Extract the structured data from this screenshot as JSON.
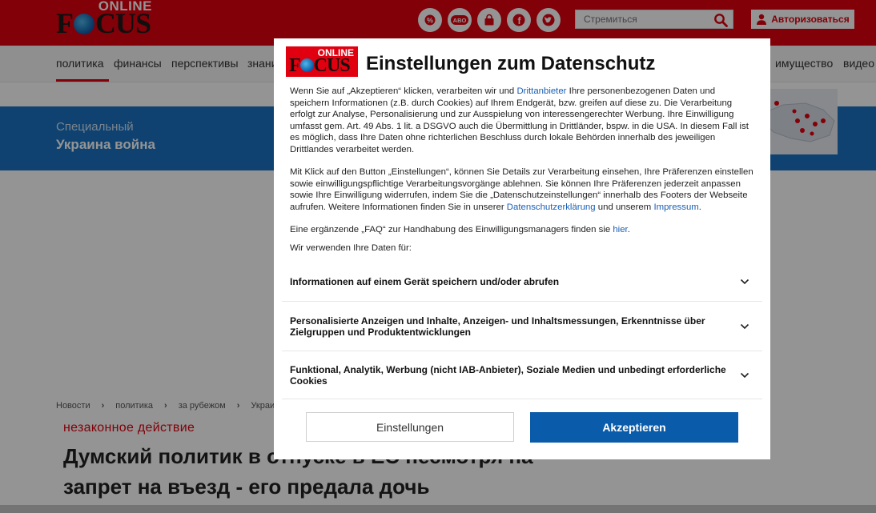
{
  "site": {
    "logo_online": "ONLINE",
    "logo_focus_pre": "F",
    "logo_focus_post": "CUS",
    "brand_color": "#e1000f",
    "top_icons": [
      {
        "name": "percent-icon",
        "label": "%"
      },
      {
        "name": "abo-icon",
        "label": "ABO"
      },
      {
        "name": "shopping-bag-icon",
        "label": ""
      },
      {
        "name": "facebook-icon",
        "label": "f"
      },
      {
        "name": "twitter-icon",
        "label": ""
      }
    ],
    "search_placeholder": "Стремиться",
    "login_label": "Авторизоваться"
  },
  "nav": {
    "items": [
      "политика",
      "финансы",
      "перспективы",
      "знания",
      "имущество",
      "видео"
    ]
  },
  "banner": {
    "line1": "Специальный",
    "line2": "Украина война",
    "color": "#1a73c2"
  },
  "breadcrumbs": [
    "Новости",
    "политика",
    "за рубежом",
    "Украина кри"
  ],
  "article": {
    "kicker": "незаконное действие",
    "headline_line1": "Думский политик в отпуске в ЕС несмотря на",
    "headline_line2": "запрет на въезд - его предала дочь"
  },
  "consent": {
    "logo_online": "ONLINE",
    "logo_focus_pre": "F",
    "logo_focus_post": "CUS",
    "title": "Einstellungen zum Datenschutz",
    "para1_a": "Wenn Sie auf „Akzeptieren“ klicken, verarbeiten wir und ",
    "para1_link": "Drittanbieter",
    "para1_b": " Ihre personenbezogenen Daten und speichern Informationen (z.B. durch Cookies) auf Ihrem Endgerät, bzw. greifen auf diese zu. Die Verarbeitung erfolgt zur Analyse, Personalisierung und zur Ausspielung von interessengerechter Werbung. Ihre Einwilligung umfasst gem. Art. 49 Abs. 1 lit. a DSGVO auch die Übermittlung in Drittländer, bspw. in die USA. In diesem Fall ist es möglich, dass Ihre Daten ohne richterlichen Beschluss durch lokale Behörden innerhalb des jeweiligen Drittlandes verarbeitet werden.",
    "para2_a": "Mit Klick auf den Button „Einstellungen“, können Sie Details zur Verarbeitung einsehen, Ihre Präferenzen einstellen sowie einwilligungspflichtige Verarbeitungsvorgänge ablehnen. Sie können Ihre Präferenzen jederzeit anpassen sowie Ihre Einwilligung widerrufen, indem Sie die „Datenschutzeinstellungen“ innerhalb des Footers der Webseite aufrufen. Weitere Informationen finden Sie in unserer ",
    "para2_link1": "Datenschutzerklärung",
    "para2_b": " und unserem ",
    "para2_link2": "Impressum",
    "para2_c": ".",
    "para3_a": "Eine ergänzende „FAQ“ zur Handhabung des Einwilligungsmanagers finden sie ",
    "para3_link": "hier",
    "para3_b": ".",
    "use_intro": "Wir verwenden Ihre Daten für:",
    "purposes": [
      "Informationen auf einem Gerät speichern und/oder abrufen",
      "Personalisierte Anzeigen und Inhalte, Anzeigen- und Inhaltsmessungen, Erkenntnisse über Zielgruppen und Produktentwicklungen",
      "Funktional, Analytik, Werbung (nicht IAB-Anbieter), Soziale Medien und unbedingt erforderliche Cookies"
    ],
    "settings_label": "Einstellungen",
    "accept_label": "Akzeptieren",
    "accept_color": "#0a5cab",
    "link_color": "#1a5fb4"
  }
}
